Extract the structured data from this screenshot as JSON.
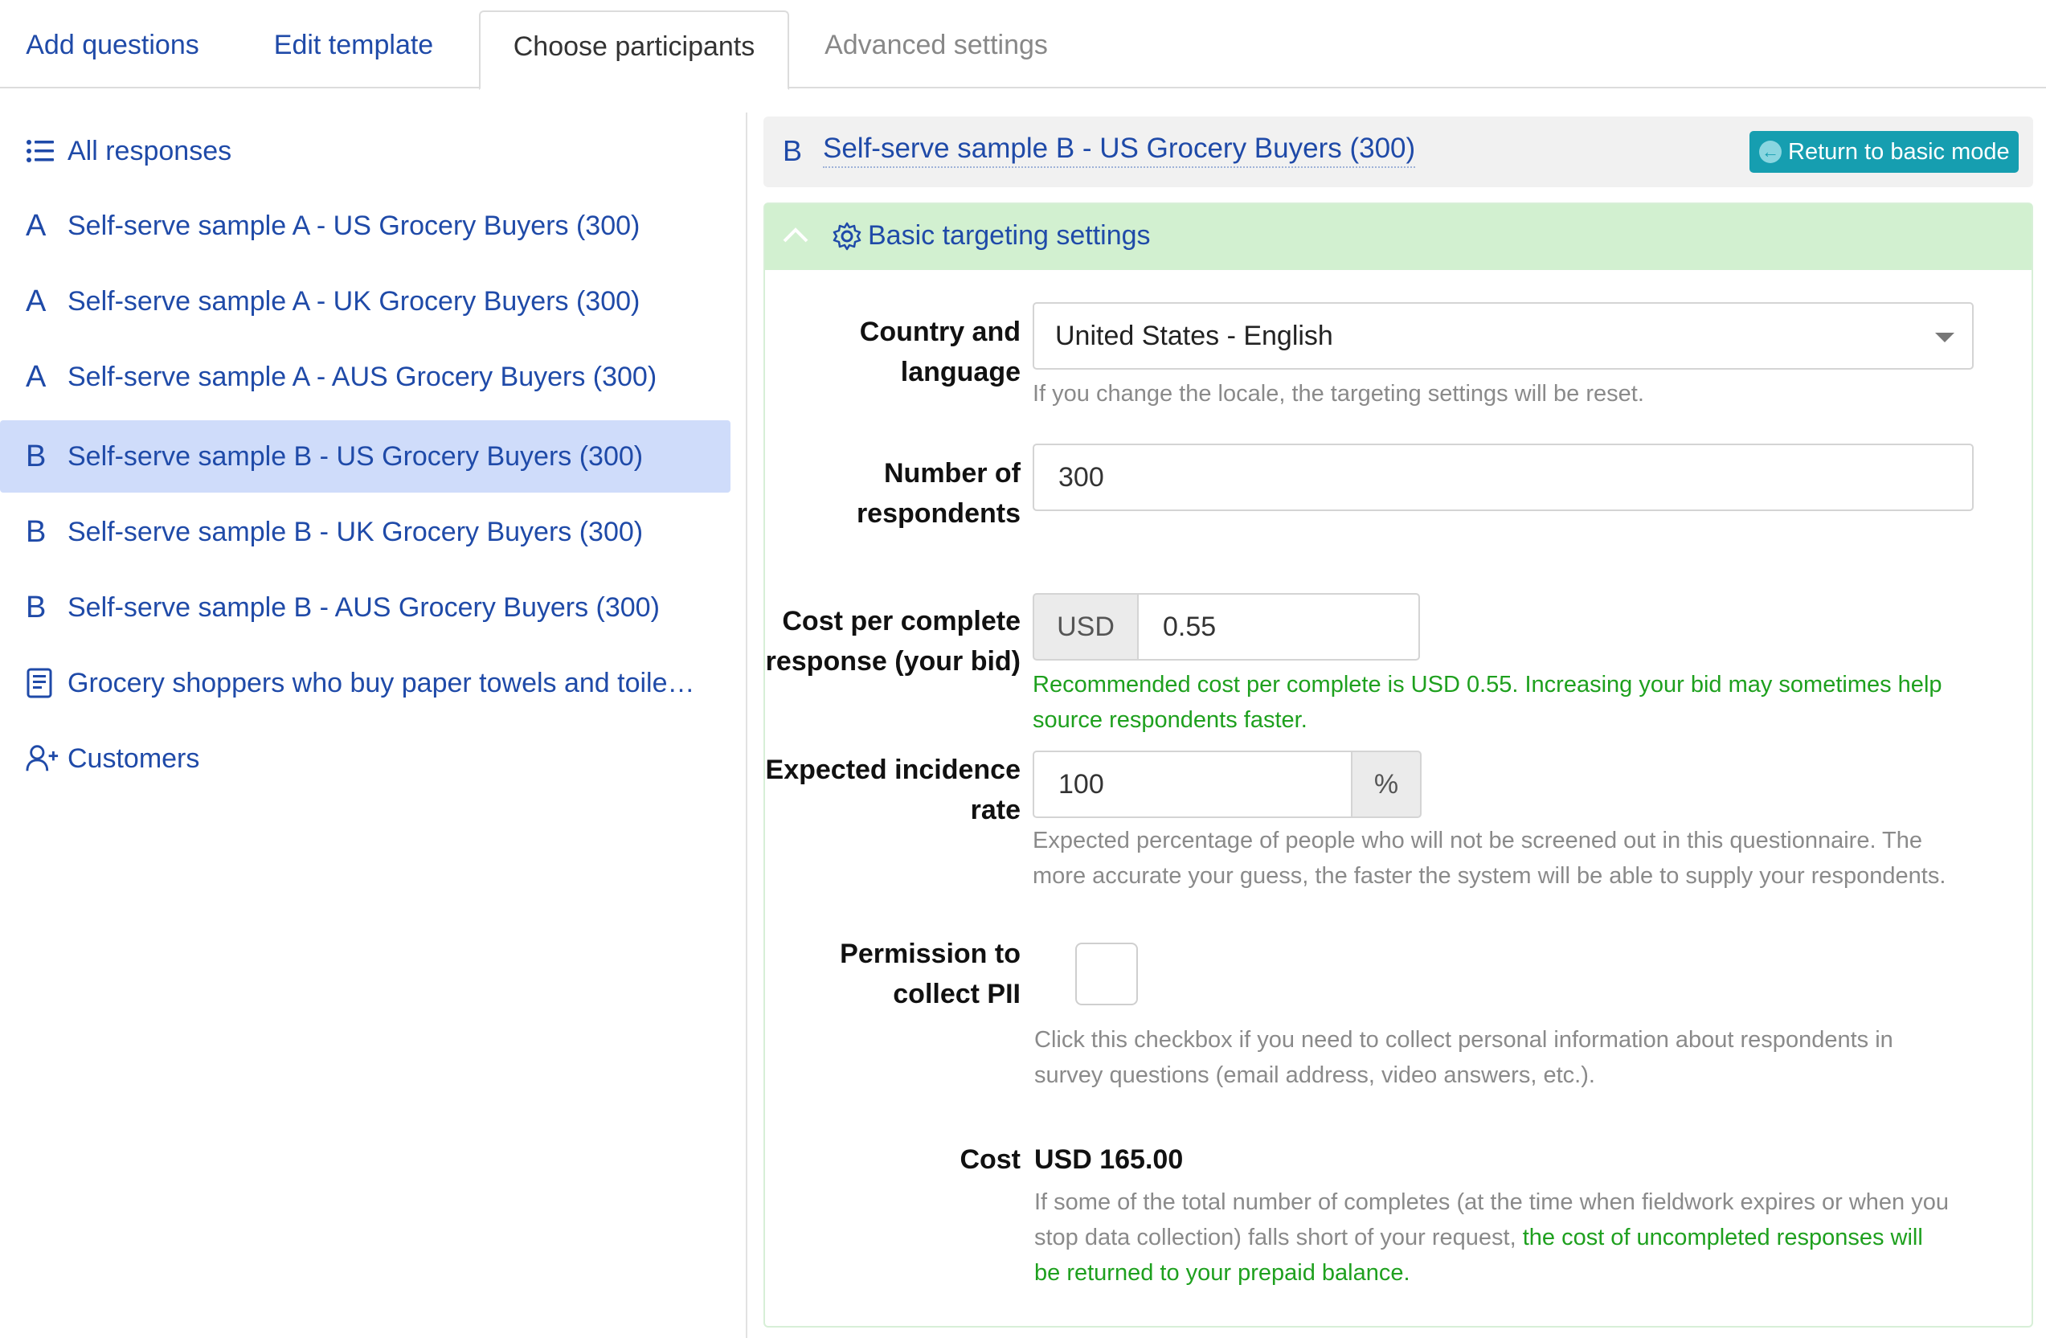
{
  "tabs": [
    {
      "label": "Add questions"
    },
    {
      "label": "Edit template"
    },
    {
      "label": "Choose participants"
    },
    {
      "label": "Advanced settings"
    }
  ],
  "sidebar": {
    "items": [
      {
        "icon": "list-icon",
        "label": "All responses"
      },
      {
        "icon": "letter-a-icon",
        "glyph": "A",
        "label": "Self-serve sample A - US Grocery Buyers (300)"
      },
      {
        "icon": "letter-a-icon",
        "glyph": "A",
        "label": "Self-serve sample A - UK Grocery Buyers (300)"
      },
      {
        "icon": "letter-a-icon",
        "glyph": "A",
        "label": "Self-serve sample A - AUS Grocery Buyers (300)"
      },
      {
        "icon": "letter-b-icon",
        "glyph": "B",
        "label": "Self-serve sample B - US Grocery Buyers (300)",
        "selected": true
      },
      {
        "icon": "letter-b-icon",
        "glyph": "B",
        "label": "Self-serve sample B - UK Grocery Buyers (300)"
      },
      {
        "icon": "letter-b-icon",
        "glyph": "B",
        "label": "Self-serve sample B - AUS Grocery Buyers (300)"
      },
      {
        "icon": "document-icon",
        "label": "Grocery shoppers who buy paper towels and toile…"
      },
      {
        "icon": "add-user-icon",
        "label": "Customers"
      }
    ]
  },
  "panel": {
    "letter": "B",
    "title": "Self-serve sample B - US Grocery Buyers (300)",
    "return_button": "Return to basic mode"
  },
  "targeting": {
    "section_title": "Basic targeting settings",
    "country": {
      "label_line1": "Country and",
      "label_line2": "language",
      "value": "United States - English",
      "help": "If you change the locale, the targeting settings will be reset."
    },
    "respondents": {
      "label_line1": "Number of",
      "label_line2": "respondents",
      "value": "300"
    },
    "cpc": {
      "label_line1": "Cost per complete",
      "label_line2": "response (your bid)",
      "currency": "USD",
      "value": "0.55",
      "help_line1": "Recommended cost per complete is USD 0.55. Increasing your bid may sometimes help",
      "help_line2": "source respondents faster."
    },
    "incidence": {
      "label_line1": "Expected incidence",
      "label_line2": "rate",
      "value": "100",
      "unit": "%",
      "help_line1": "Expected percentage of people who will not be screened out in this questionnaire. The",
      "help_line2": "more accurate your guess, the faster the system will be able to supply your respondents."
    },
    "pii": {
      "label_line1": "Permission to",
      "label_line2": "collect PII",
      "checked": false,
      "help_line1": "Click this checkbox if you need to collect personal information about respondents in",
      "help_line2": "survey questions (email address, video answers, etc.)."
    },
    "cost": {
      "label": "Cost",
      "value": "USD 165.00",
      "help_line1": "If some of the total number of completes (at the time when fieldwork expires or when you",
      "help_line2_gray": "stop data collection) falls short of your request,",
      "help_line2_green": " the cost of uncompleted responses will",
      "help_line3_green": "be returned to your prepaid balance."
    }
  },
  "colors": {
    "link": "#1f4aa8",
    "selected_bg": "#cfdcfa",
    "section_bg": "#d2f0d0",
    "button": "#169eb0",
    "success_text": "#1ea01e"
  }
}
